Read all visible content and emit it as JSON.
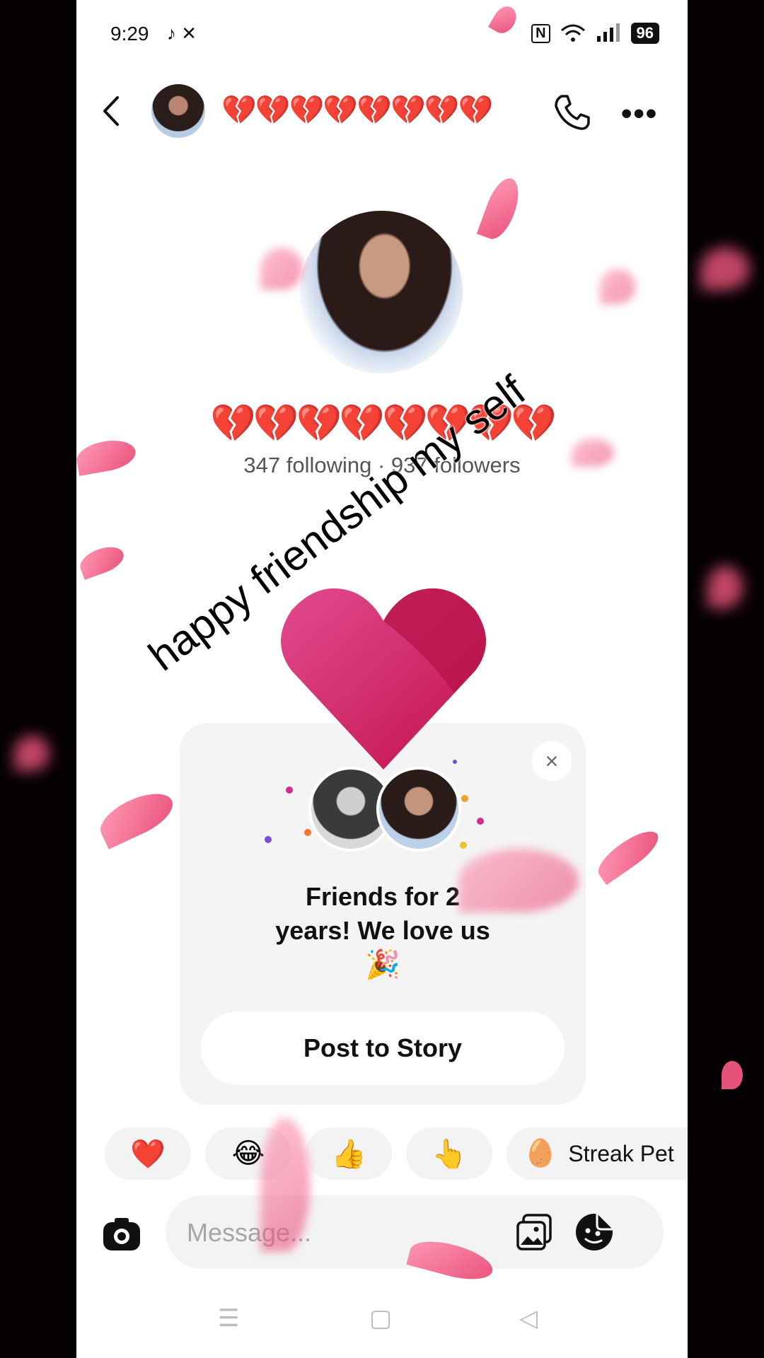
{
  "status_bar": {
    "time": "9:29",
    "left_icons": "♪ ✕",
    "nfc": "N",
    "battery": "96"
  },
  "header": {
    "title": "💔💔💔💔💔💔💔💔"
  },
  "profile": {
    "name": "💔💔💔💔💔💔💔💔",
    "stats": "347 following · 937 followers"
  },
  "caption": "happy friendship my self",
  "card": {
    "line1": "Friends for 2",
    "line2": "years! We love us",
    "emoji": "🎉",
    "close": "×",
    "button": "Post to Story"
  },
  "reactions": [
    {
      "emoji": "❤️"
    },
    {
      "emoji": "😂"
    },
    {
      "emoji": "👍"
    },
    {
      "emoji": "👆"
    },
    {
      "emoji": "🥚",
      "label": "Streak Pet"
    }
  ],
  "composer": {
    "placeholder": "Message..."
  },
  "nav": {
    "menu": "☰",
    "home": "▢",
    "back": "◁"
  },
  "colors": {
    "accent_heart": "#d81b5a",
    "petal": "#ff6e94"
  }
}
